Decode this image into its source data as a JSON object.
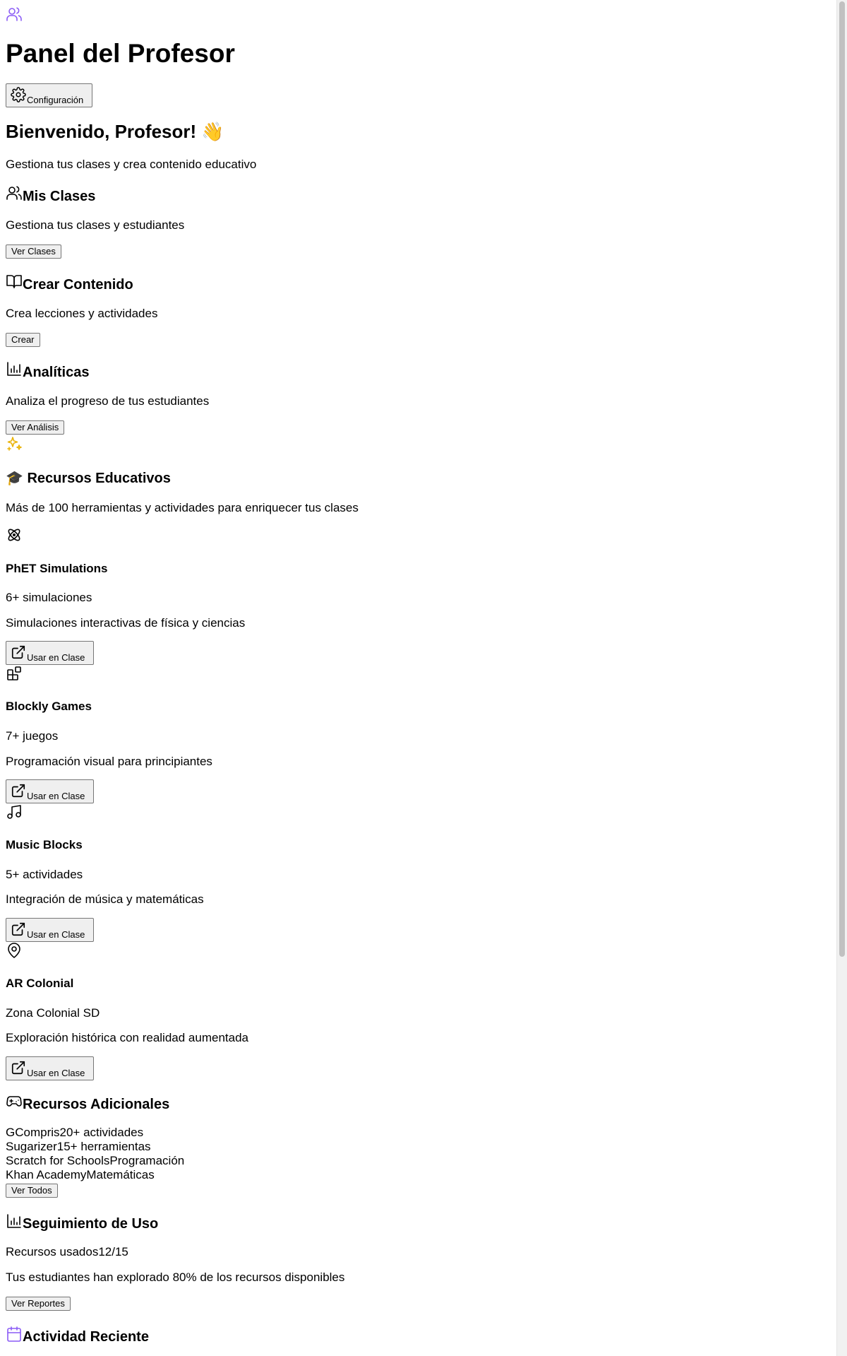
{
  "header": {
    "title": "Panel del Profesor",
    "settings_label": "Configuración"
  },
  "welcome": {
    "title": "Bienvenido, Profesor! 👋",
    "subtitle": "Gestiona tus clases y crea contenido educativo"
  },
  "cards": [
    {
      "icon": "users-icon",
      "title": "Mis Clases",
      "description": "Gestiona tus clases y estudiantes",
      "button": "Ver Clases"
    },
    {
      "icon": "book-open-icon",
      "title": "Crear Contenido",
      "description": "Crea lecciones y actividades",
      "button": "Crear"
    },
    {
      "icon": "bar-chart-icon",
      "title": "Analíticas",
      "description": "Analiza el progreso de tus estudiantes",
      "button": "Ver Análisis"
    }
  ],
  "resources": {
    "icon": "sparkles-icon",
    "title": "🎓 Recursos Educativos",
    "subtitle": "Más de 100 herramientas y actividades para enriquecer tus clases",
    "items": [
      {
        "icon": "atom-icon",
        "name": "PhET Simulations",
        "count": "6+ simulaciones",
        "description": "Simulaciones interactivas de física y ciencias",
        "button": "Usar en Clase"
      },
      {
        "icon": "blocks-icon",
        "name": "Blockly Games",
        "count": "7+ juegos",
        "description": "Programación visual para principiantes",
        "button": "Usar en Clase"
      },
      {
        "icon": "music-icon",
        "name": "Music Blocks",
        "count": "5+ actividades",
        "description": "Integración de música y matemáticas",
        "button": "Usar en Clase"
      },
      {
        "icon": "map-pin-icon",
        "name": "AR Colonial",
        "count": "Zona Colonial SD",
        "description": "Exploración histórica con realidad aumentada",
        "button": "Usar en Clase"
      }
    ]
  },
  "additional": {
    "icon": "gamepad-icon",
    "title": "Recursos Adicionales",
    "items": [
      {
        "name": "GCompris",
        "detail": "20+ actividades"
      },
      {
        "name": "Sugarizer",
        "detail": "15+ herramientas"
      },
      {
        "name": "Scratch for Schools",
        "detail": "Programación"
      },
      {
        "name": "Khan Academy",
        "detail": "Matemáticas"
      }
    ],
    "button": "Ver Todos"
  },
  "usage": {
    "icon": "bar-chart-icon",
    "title": "Seguimiento de Uso",
    "label": "Recursos usados",
    "value": "12/15",
    "progress_percent": 80,
    "note": "Tus estudiantes han explorado 80% de los recursos disponibles",
    "button": "Ver Reportes"
  },
  "recent": {
    "icon": "calendar-icon",
    "title": "Actividad Reciente"
  },
  "colors": {
    "accent_purple": "#8b5cf6",
    "accent_amber": "#eab308"
  }
}
